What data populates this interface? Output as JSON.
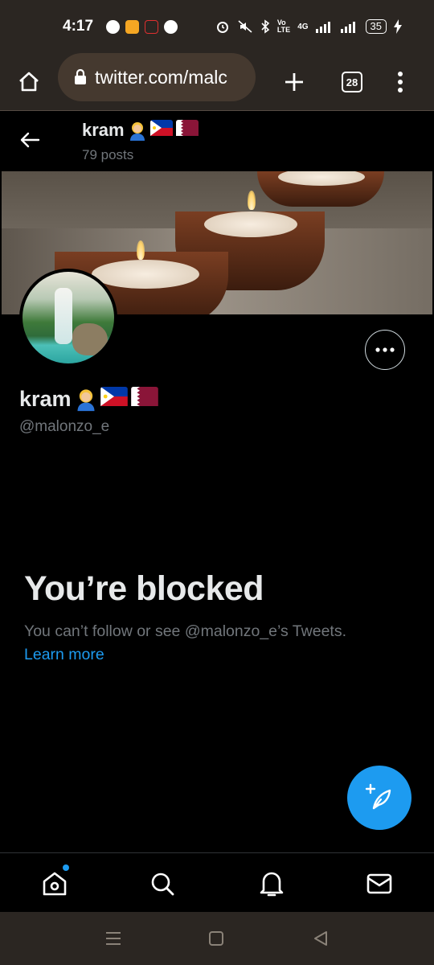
{
  "status_bar": {
    "time": "4:17",
    "network": "4G",
    "battery": "35"
  },
  "browser": {
    "url": "twitter.com/malc",
    "tab_count": "28"
  },
  "header": {
    "name": "kram",
    "posts": "79 posts"
  },
  "profile": {
    "name": "kram",
    "handle": "@malonzo_e"
  },
  "blocked": {
    "title": "You’re blocked",
    "message": "You can’t follow or see @malonzo_e’s Tweets.",
    "link": "Learn more"
  },
  "colors": {
    "accent": "#1d9bf0",
    "background": "#000000",
    "muted": "#71767b",
    "browser_chrome": "#2b2622"
  },
  "icons": {
    "home": "home-icon",
    "search": "search-icon",
    "notifications": "bell-icon",
    "messages": "mail-icon",
    "compose": "compose-feather-icon"
  }
}
